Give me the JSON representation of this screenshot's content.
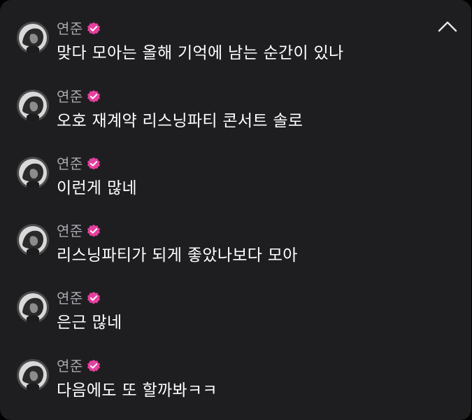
{
  "messages": [
    {
      "author": "연준",
      "verified": true,
      "text": "맞다 모아는 올해 기억에 남는 순간이 있나"
    },
    {
      "author": "연준",
      "verified": true,
      "text": "오호 재계약 리스닝파티 콘서트 솔로"
    },
    {
      "author": "연준",
      "verified": true,
      "text": "이런게 많네"
    },
    {
      "author": "연준",
      "verified": true,
      "text": "리스닝파티가 되게 좋았나보다 모아"
    },
    {
      "author": "연준",
      "verified": true,
      "text": "은근 많네"
    },
    {
      "author": "연준",
      "verified": true,
      "text": "다음에도 또 할까봐ㅋㅋ"
    }
  ],
  "icons": {
    "collapse": "chevron-up-icon",
    "verified": "verified-badge-icon"
  },
  "colors": {
    "background": "#1e1e20",
    "name": "#a8a8ad",
    "text": "#ffffff",
    "verified": "#e83e9e"
  }
}
